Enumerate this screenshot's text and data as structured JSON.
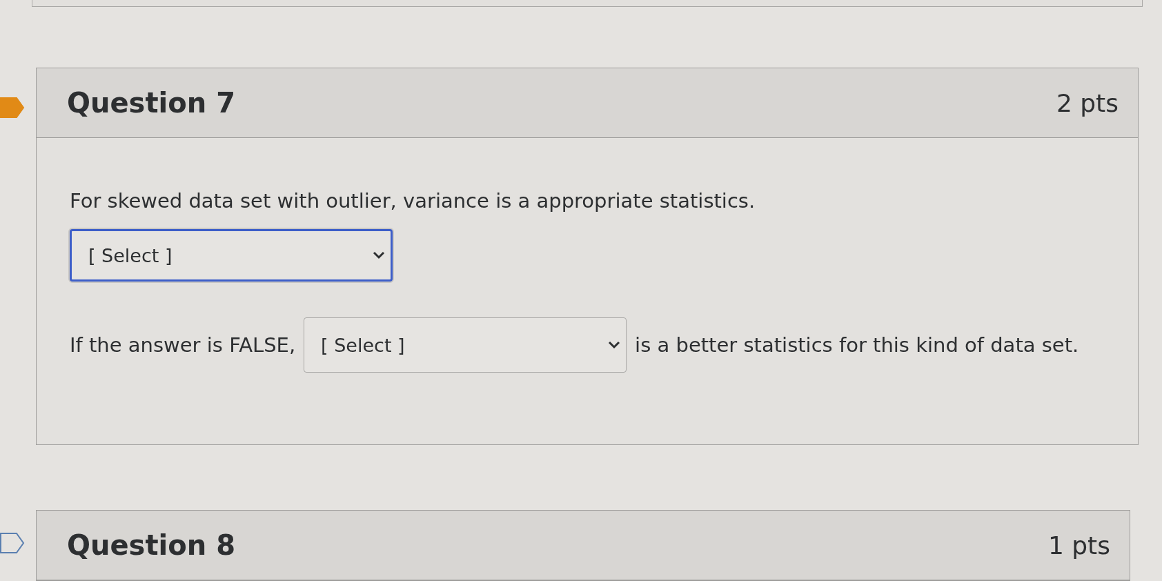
{
  "questions": [
    {
      "title": "Question 7",
      "points": "2 pts",
      "flagged": true,
      "body": {
        "prompt": "For skewed data set with outlier, variance is a appropriate statistics.",
        "answer_select": {
          "value": "[ Select ]",
          "focused": true
        },
        "sentence_before": "If the answer is FALSE,",
        "inline_select": {
          "value": "[ Select ]",
          "focused": false
        },
        "sentence_after": "is a better statistics for this kind of data set."
      }
    },
    {
      "title": "Question 8",
      "points": "1 pts",
      "flagged": false
    }
  ]
}
